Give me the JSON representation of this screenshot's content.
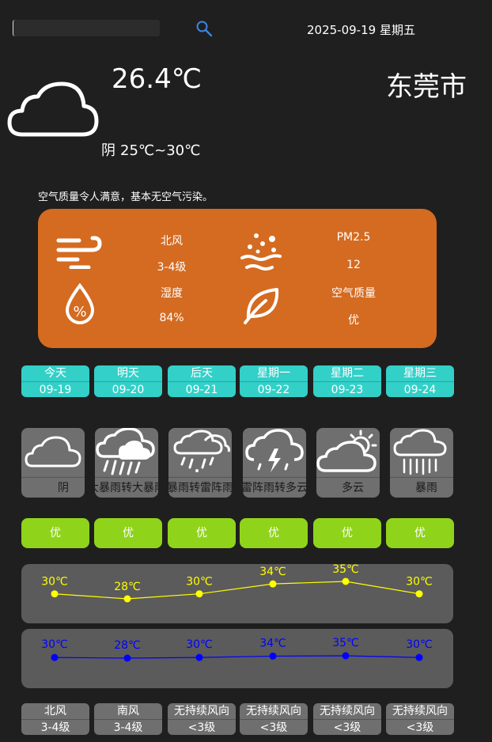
{
  "header": {
    "search_value": "",
    "date": "2025-09-19 星期五"
  },
  "current": {
    "temperature": "26.4℃",
    "city": "东莞市",
    "condition": "阴",
    "range": "25℃~30℃",
    "aqi_note": "空气质量令人满意，基本无空气污染。"
  },
  "panel": {
    "wind_dir": "北风",
    "wind_level": "3-4级",
    "pm_label": "PM2.5",
    "pm_value": "12",
    "humidity_label": "湿度",
    "humidity_value": "84%",
    "quality_label": "空气质量",
    "quality_value": "优",
    "color": "#d46b21"
  },
  "days": [
    {
      "day": "今天",
      "date": "09-19",
      "weather": "阴",
      "icon": "cloud-icon",
      "aqi": "优",
      "high": "30℃",
      "low": "30℃",
      "wind_dir": "北风",
      "wind_level": "3-4级"
    },
    {
      "day": "明天",
      "date": "09-20",
      "weather": "大暴雨转大暴雨",
      "icon": "heavy-rain-icon",
      "aqi": "优",
      "high": "28℃",
      "low": "28℃",
      "wind_dir": "南风",
      "wind_level": "3-4级"
    },
    {
      "day": "后天",
      "date": "09-21",
      "weather": "暴雨转雷阵雨",
      "icon": "rain-storm-icon",
      "aqi": "优",
      "high": "30℃",
      "low": "30℃",
      "wind_dir": "无持续风向",
      "wind_level": "<3级"
    },
    {
      "day": "星期一",
      "date": "09-22",
      "weather": "雷阵雨转多云",
      "icon": "thunder-icon",
      "aqi": "优",
      "high": "34℃",
      "low": "34℃",
      "wind_dir": "无持续风向",
      "wind_level": "<3级"
    },
    {
      "day": "星期二",
      "date": "09-23",
      "weather": "多云",
      "icon": "partly-cloudy-icon",
      "aqi": "优",
      "high": "35℃",
      "low": "35℃",
      "wind_dir": "无持续风向",
      "wind_level": "<3级"
    },
    {
      "day": "星期三",
      "date": "09-24",
      "weather": "暴雨",
      "icon": "rain-icon",
      "aqi": "优",
      "high": "30℃",
      "low": "30℃",
      "wind_dir": "无持续风向",
      "wind_level": "<3级"
    }
  ],
  "colors": {
    "tab": "#33d0c8",
    "aqi_good": "#8fd41a",
    "high_line": "#ffff00",
    "low_line": "#0000ff"
  },
  "chart_data": [
    {
      "type": "line",
      "x": [
        "09-19",
        "09-20",
        "09-21",
        "09-22",
        "09-23",
        "09-24"
      ],
      "series": [
        {
          "values": [
            30,
            28,
            30,
            34,
            35,
            30
          ],
          "color": "#ffff00"
        }
      ],
      "labels": [
        "30℃",
        "28℃",
        "30℃",
        "34℃",
        "35℃",
        "30℃"
      ]
    },
    {
      "type": "line",
      "x": [
        "09-19",
        "09-20",
        "09-21",
        "09-22",
        "09-23",
        "09-24"
      ],
      "series": [
        {
          "values": [
            30,
            28,
            30,
            34,
            35,
            30
          ],
          "color": "#0000ff"
        }
      ],
      "labels": [
        "30℃",
        "28℃",
        "30℃",
        "34℃",
        "35℃",
        "30℃"
      ]
    }
  ]
}
